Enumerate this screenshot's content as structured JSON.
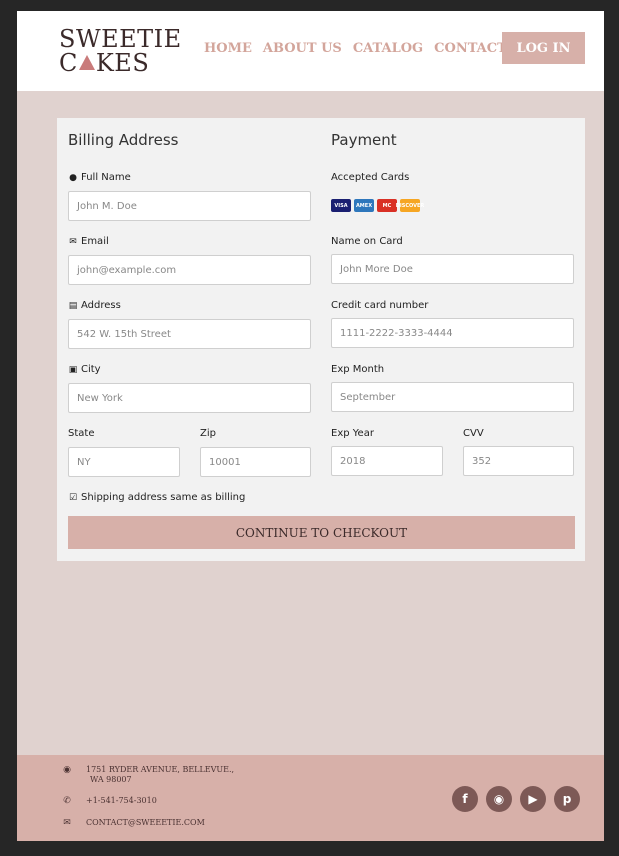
{
  "brand": {
    "line1": "SWEETIE",
    "line2_a": "C",
    "line2_b": "KES"
  },
  "nav": {
    "items": [
      "HOME",
      "ABOUT US",
      "CATALOG",
      "CONTACT US"
    ],
    "login": "LOG IN"
  },
  "billing": {
    "title": "Billing Address",
    "full_name_label": "Full Name",
    "full_name_placeholder": "John M. Doe",
    "email_label": "Email",
    "email_placeholder": "john@example.com",
    "address_label": "Address",
    "address_placeholder": "542 W. 15th Street",
    "city_label": "City",
    "city_placeholder": "New York",
    "state_label": "State",
    "state_placeholder": "NY",
    "zip_label": "Zip",
    "zip_placeholder": "10001"
  },
  "payment": {
    "title": "Payment",
    "accepted_label": "Accepted Cards",
    "cards": [
      "VISA",
      "AMEX",
      "MC",
      "DISCOVER"
    ],
    "name_label": "Name on Card",
    "name_placeholder": "John More Doe",
    "number_label": "Credit card number",
    "number_placeholder": "1111-2222-3333-4444",
    "month_label": "Exp Month",
    "month_placeholder": "September",
    "year_label": "Exp Year",
    "year_placeholder": "2018",
    "cvv_label": "CVV",
    "cvv_placeholder": "352"
  },
  "shipping_same": "Shipping address same as billing",
  "checkout_button": "CONTINUE TO CHECKOUT",
  "footer": {
    "address_line1": "1751 RYDER AVENUE, BELLEVUE.,",
    "address_line2": "WA 98007",
    "phone": "+1-541-754-3010",
    "email": "CONTACT@SWEEETIE.COM",
    "socials": [
      "facebook-icon",
      "instagram-icon",
      "youtube-icon",
      "pinterest-icon"
    ]
  },
  "colors": {
    "accent": "#d7b0a9",
    "nav_text": "#d3a59b",
    "background": "#e0d2cf",
    "social_bg": "#7d5956"
  }
}
